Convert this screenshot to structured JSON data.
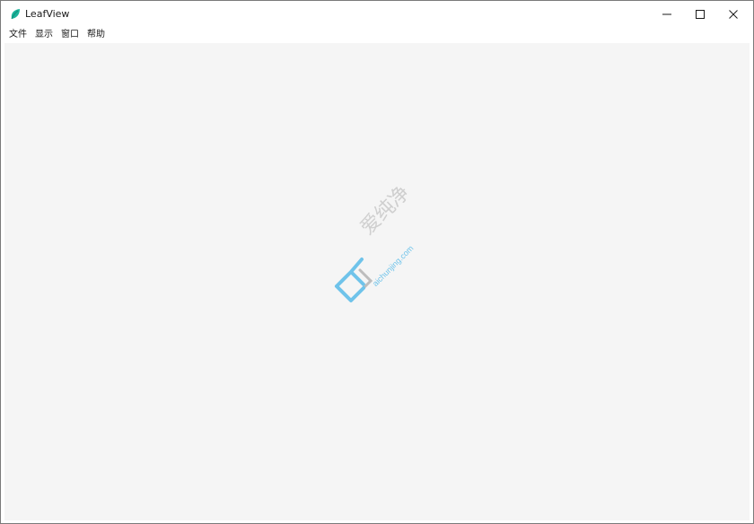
{
  "window": {
    "title": "LeafView"
  },
  "menu": {
    "items": [
      "文件",
      "显示",
      "窗口",
      "帮助"
    ]
  },
  "watermark": {
    "text_cn": "爱纯净",
    "url": "aichunjing.com"
  },
  "icons": {
    "app": "leaf-icon",
    "minimize": "minimize-icon",
    "maximize": "maximize-icon",
    "close": "close-icon"
  },
  "colors": {
    "titlebar": "#ffffff",
    "content_bg": "#f5f5f5",
    "app_icon": "#1bb39a",
    "watermark_blue": "#6fc3ea"
  }
}
